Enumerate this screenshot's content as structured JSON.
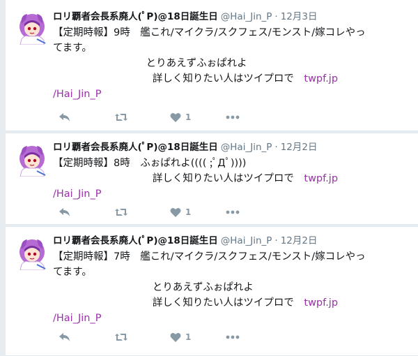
{
  "tweets": [
    {
      "fullname": "ロリ覇者会長系廃人(ﾟP)@18日誕生日",
      "screenname": "@Hai_Jin_P",
      "time": "12月3日",
      "text_lines": [
        "【定期時報】9時　艦これ/マイクラ/スクフェス/モンスト/嫁コレやっ",
        "てます。",
        "                             とりあえずふぉぱれよ",
        "                               詳しく知りたい人はツイプロで　"
      ],
      "link_inline": "twpf.jp",
      "link_line": "/Hai_Jin_P",
      "like_count": "1"
    },
    {
      "fullname": "ロリ覇者会長系廃人(ﾟP)@18日誕生日",
      "screenname": "@Hai_Jin_P",
      "time": "12月2日",
      "text_lines": [
        "【定期時報】8時　ふぉぱれよ(((( ;ﾟДﾟ))))",
        "                               詳しく知りたい人はツイプロで　"
      ],
      "link_inline": "twpf.jp",
      "link_line": "/Hai_Jin_P",
      "like_count": "1"
    },
    {
      "fullname": "ロリ覇者会長系廃人(ﾟP)@18日誕生日",
      "screenname": "@Hai_Jin_P",
      "time": "12月2日",
      "text_lines": [
        "【定期時報】7時　艦これ/マイクラ/スクフェス/モンスト/嫁コレやっ",
        "てます。",
        "                               とりあえずふぉぱれよ",
        "                               詳しく知りたい人はツイプロで　"
      ],
      "link_inline": "twpf.jp",
      "link_line": "/Hai_Jin_P",
      "like_count": "1"
    }
  ],
  "icons": {
    "reply": "reply-icon",
    "retweet": "retweet-icon",
    "like": "heart-icon",
    "more": "more-icon"
  },
  "colors": {
    "background": "#e6ecf0",
    "card": "#ffffff",
    "link": "#9a30a8",
    "muted": "#657786",
    "action": "#8899a6",
    "text": "#14171a"
  }
}
